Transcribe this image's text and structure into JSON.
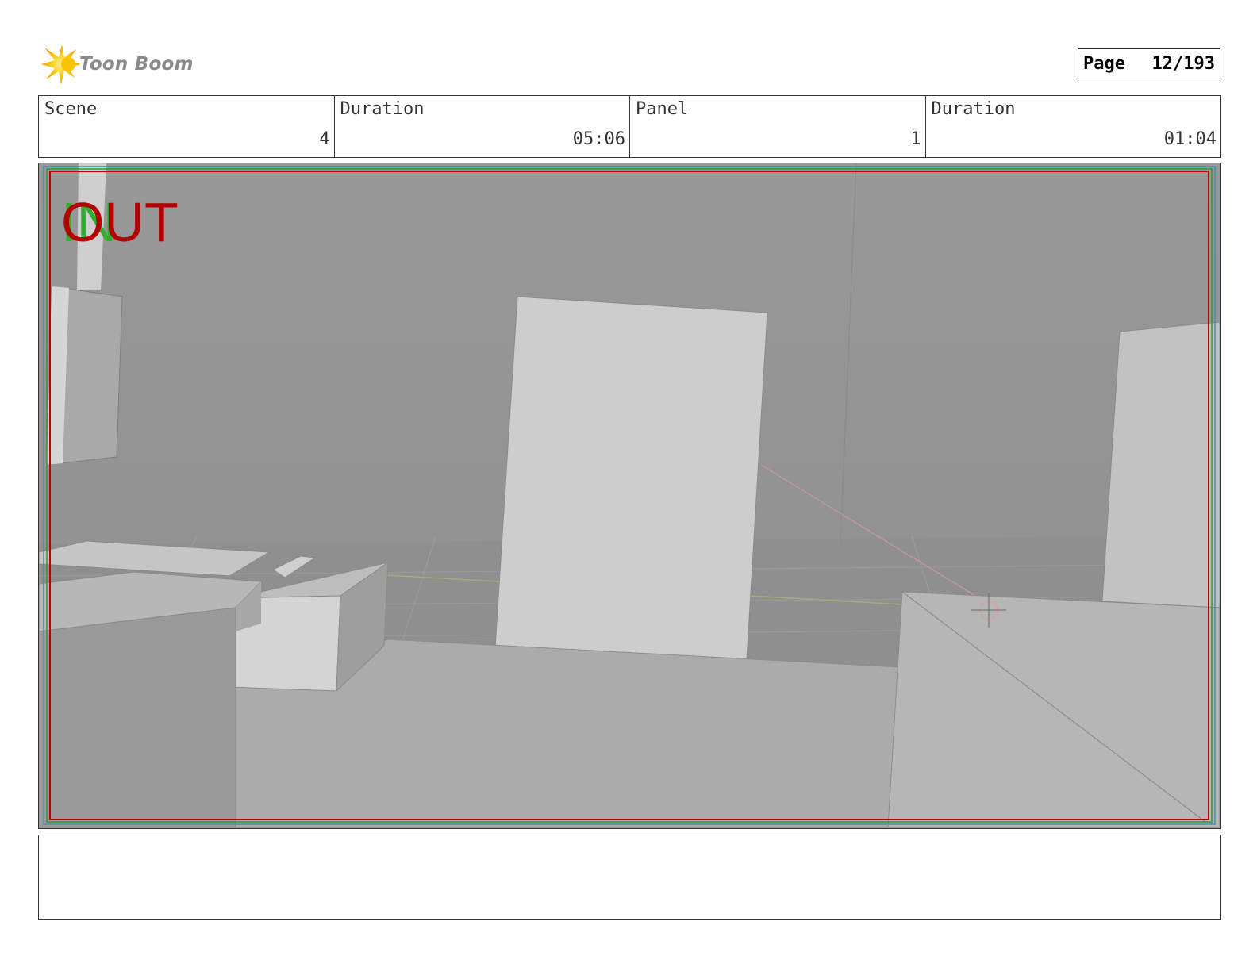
{
  "header": {
    "logo_text": "Toon Boom",
    "logo_icon": "starburst-logo-icon",
    "page_label": "Page",
    "page_value": "12/193"
  },
  "info": {
    "scene_label": "Scene",
    "scene_value": "4",
    "scene_duration_label": "Duration",
    "scene_duration_value": "05:06",
    "panel_label": "Panel",
    "panel_value": "1",
    "panel_duration_label": "Duration",
    "panel_duration_value": "01:04"
  },
  "panel_image": {
    "in_marker": "IN",
    "out_marker": "OUT",
    "in_color": "#2fae2f",
    "out_color": "#b30000",
    "safe_frame_color": "#c00000"
  },
  "notes": {
    "text": ""
  }
}
